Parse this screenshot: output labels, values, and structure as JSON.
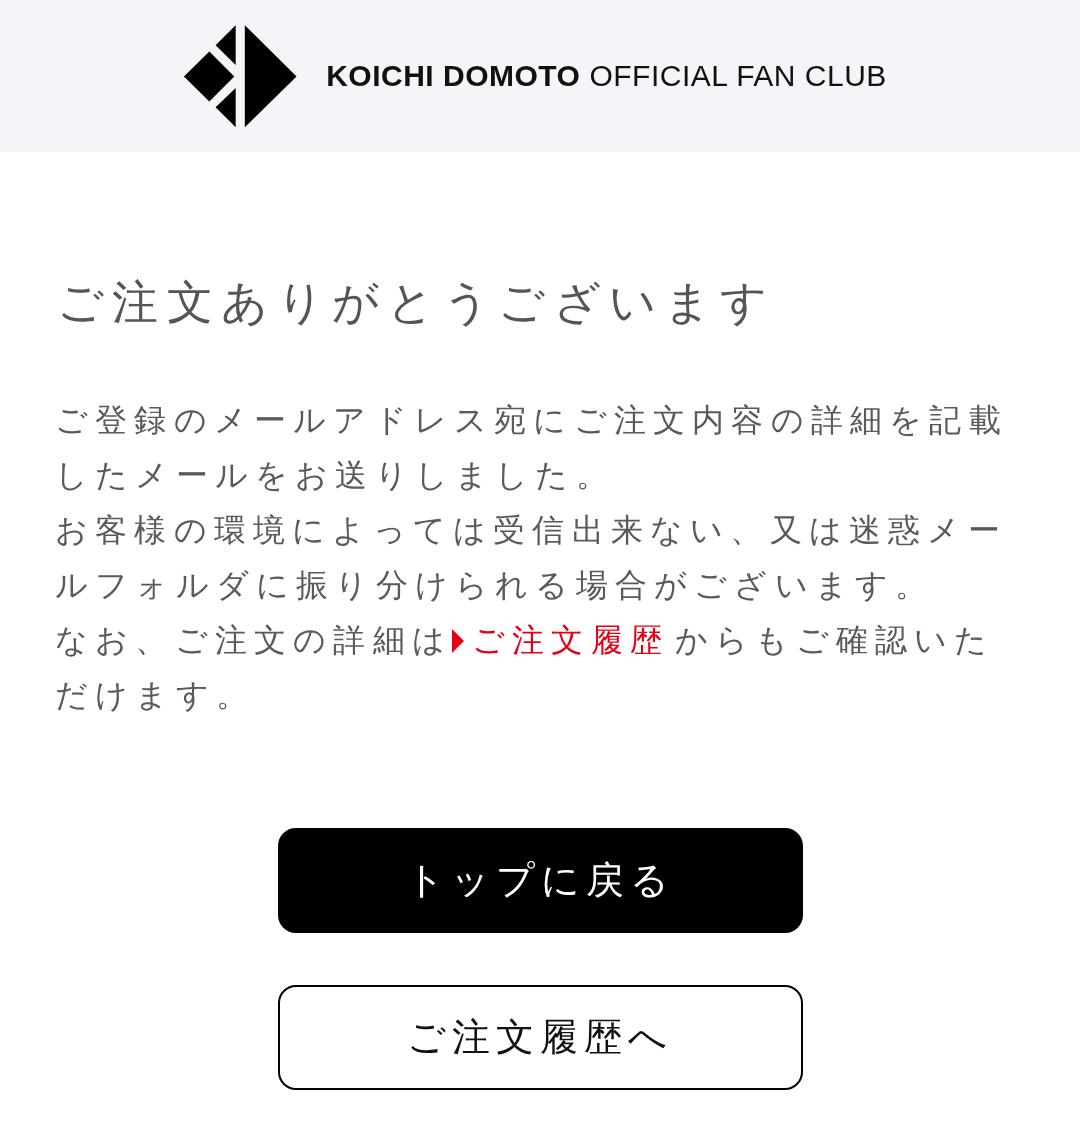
{
  "header": {
    "logo_bold": "KOICHI DOMOTO",
    "logo_light": "OFFICIAL FAN CLUB"
  },
  "title": "ご注文ありがとうございます",
  "paragraphs": [
    {
      "kind": "text",
      "text": "ご登録のメールアドレス宛にご注文内容の詳細を記載したメールをお送りしました。"
    },
    {
      "kind": "text",
      "text": "お客様の環境によっては受信出来ない、又は迷惑メールフォルダに振り分けられる場合がございます。"
    },
    {
      "kind": "link",
      "before": "なお、ご注文の詳細は",
      "link": "ご注文履歴",
      "after": "からもご確認いただけます。"
    }
  ],
  "buttons": [
    {
      "label": "トップに戻る",
      "kind": "primary"
    },
    {
      "label": "ご注文履歴へ",
      "kind": "secondary"
    }
  ]
}
